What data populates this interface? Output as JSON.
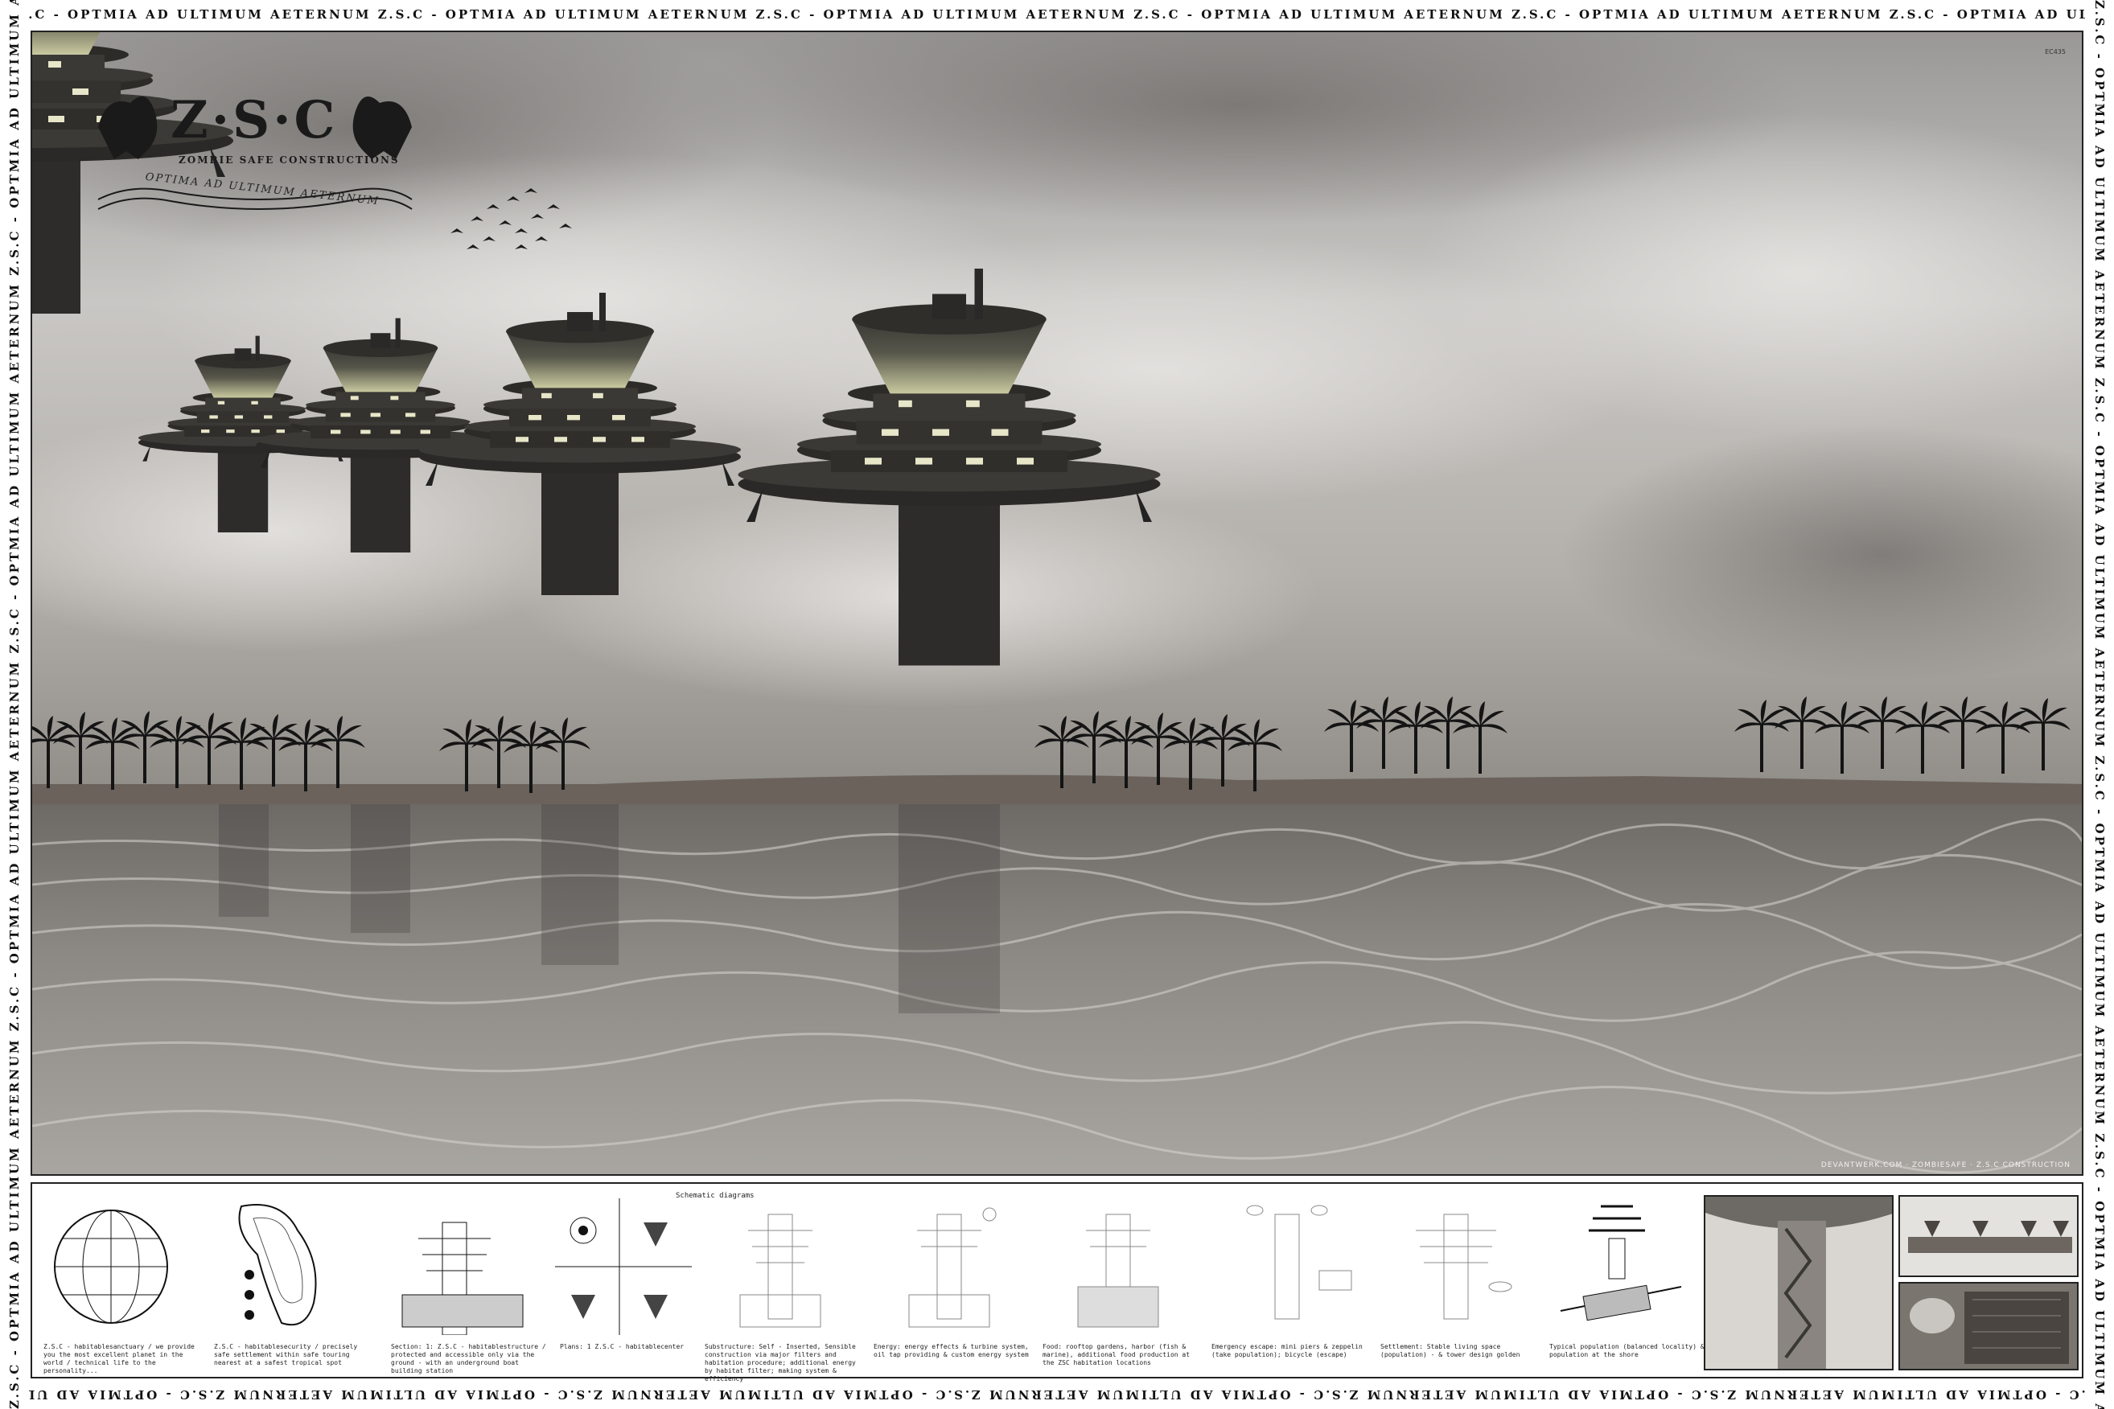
{
  "border": {
    "text": "Z.S.C - OPTMIA AD ULTIMUM AETERNUM Z.S.C - OPTMIA AD ULTIMUM AETERNUM Z.S.C - OPTMIA AD ULTIMUM AETERNUM Z.S.C - OPTMIA AD ULTIMUM AETERNUM Z.S.C - OPTMIA AD ULTIMUM AETERNUM Z.S.C - OPTMIA AD ULTIMUM AETERNUM"
  },
  "logo": {
    "title": "Z·S·C",
    "subtitle": "ZOMBIE SAFE CONSTRUCTIONS",
    "motto": "OPTIMA AD ULTIMUM AETERNUM"
  },
  "scene": {
    "corner_label": "EC435",
    "credit": "DEVANTWERK.COM · ZOMBIESAFE · Z.S.C CONSTRUCTION"
  },
  "sheet": {
    "diagram_title": "Schematic diagrams",
    "captions": [
      "Z.S.C - habitablesanctuary / we provide you the most excellent planet in the world / technical life to the personality...",
      "Z.S.C - habitablesecurity / precisely safe settlement within safe touring nearest at a safest tropical spot",
      "Section: 1: Z.S.C - habitablestructure / protected and accessible only via the ground - with an underground boat building station",
      "Plans: 1 Z.S.C - habitablecenter",
      "Substructure: Self - Inserted, Sensible construction via major filters and habitation procedure; additional energy by habitat filter; making system & efficiency",
      "Energy: energy effects & turbine system, oil tap providing & custom energy system",
      "Food: rooftop gardens, harbor (fish & marine), additional food production at the ZSC habitation locations",
      "Emergency escape: mini piers & zeppelin (take population); bicycle (escape)",
      "Settlement: Stable living space (population) - & tower design golden",
      "Typical population (balanced locality) & population at the shore"
    ]
  }
}
